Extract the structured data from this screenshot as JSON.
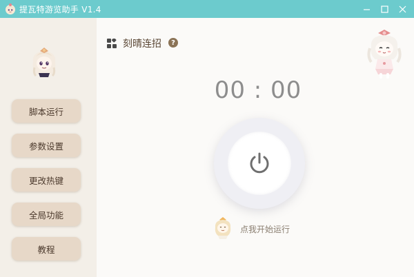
{
  "window": {
    "title": "提瓦特游览助手 V1.4",
    "minimize_icon": "minimize-icon",
    "maximize_icon": "maximize-icon",
    "close_icon": "close-icon",
    "titlebar_color": "#6ccbcd"
  },
  "sidebar": {
    "items": [
      {
        "label": "脚本运行"
      },
      {
        "label": "参数设置"
      },
      {
        "label": "更改热键"
      },
      {
        "label": "全局功能"
      },
      {
        "label": "教程"
      }
    ]
  },
  "main": {
    "mode_icon": "apps-icon",
    "mode_label": "刻晴连招",
    "help_label": "?",
    "timer": "00 : 00",
    "power_icon": "power-icon",
    "hint": "点我开始运行"
  }
}
